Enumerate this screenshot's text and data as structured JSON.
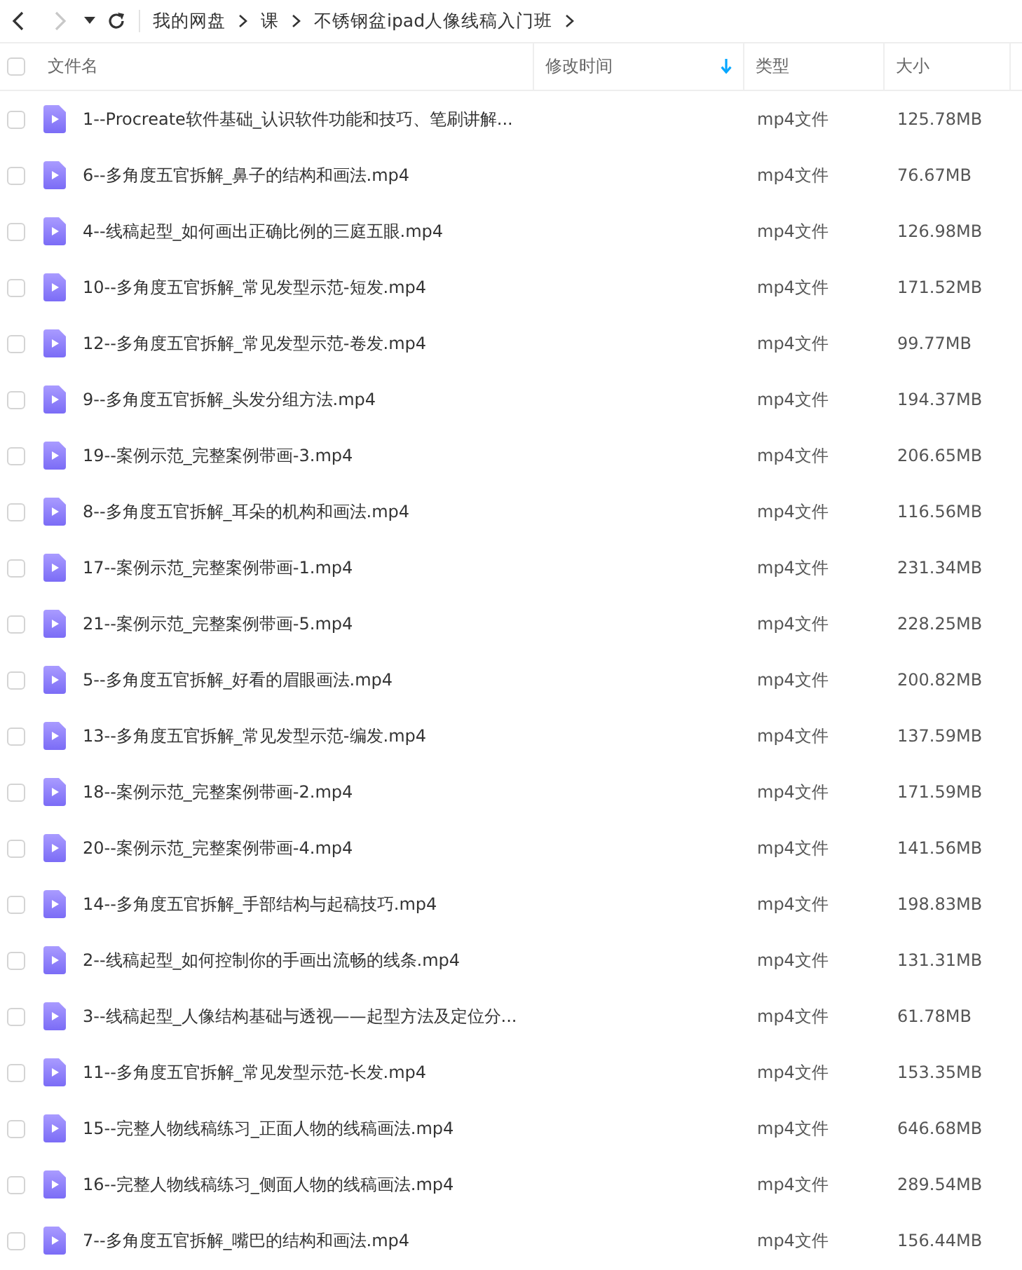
{
  "toolbar": {
    "back": {
      "disabled": false
    },
    "forward": {
      "disabled": true
    }
  },
  "breadcrumb": [
    "我的网盘",
    "课",
    "不锈钢盆ipad人像线稿入门班"
  ],
  "table": {
    "select_all": {
      "checked": false
    },
    "columns": [
      {
        "label": "文件名",
        "sorted": false
      },
      {
        "label": "修改时间",
        "sorted": true
      },
      {
        "label": "类型",
        "sorted": false
      },
      {
        "label": "大小",
        "sorted": false
      }
    ],
    "rows": [
      {
        "name": "1--Procreate软件基础_认识软件功能和技巧、笔刷讲解...",
        "type": "mp4文件",
        "size": "125.78MB",
        "checked": false
      },
      {
        "name": "6--多角度五官拆解_鼻子的结构和画法.mp4",
        "type": "mp4文件",
        "size": "76.67MB",
        "checked": false
      },
      {
        "name": "4--线稿起型_如何画出正确比例的三庭五眼.mp4",
        "type": "mp4文件",
        "size": "126.98MB",
        "checked": false
      },
      {
        "name": "10--多角度五官拆解_常见发型示范-短发.mp4",
        "type": "mp4文件",
        "size": "171.52MB",
        "checked": false
      },
      {
        "name": "12--多角度五官拆解_常见发型示范-卷发.mp4",
        "type": "mp4文件",
        "size": "99.77MB",
        "checked": false
      },
      {
        "name": "9--多角度五官拆解_头发分组方法.mp4",
        "type": "mp4文件",
        "size": "194.37MB",
        "checked": false
      },
      {
        "name": "19--案例示范_完整案例带画-3.mp4",
        "type": "mp4文件",
        "size": "206.65MB",
        "checked": false
      },
      {
        "name": "8--多角度五官拆解_耳朵的机构和画法.mp4",
        "type": "mp4文件",
        "size": "116.56MB",
        "checked": false
      },
      {
        "name": "17--案例示范_完整案例带画-1.mp4",
        "type": "mp4文件",
        "size": "231.34MB",
        "checked": false
      },
      {
        "name": "21--案例示范_完整案例带画-5.mp4",
        "type": "mp4文件",
        "size": "228.25MB",
        "checked": false
      },
      {
        "name": "5--多角度五官拆解_好看的眉眼画法.mp4",
        "type": "mp4文件",
        "size": "200.82MB",
        "checked": false
      },
      {
        "name": "13--多角度五官拆解_常见发型示范-编发.mp4",
        "type": "mp4文件",
        "size": "137.59MB",
        "checked": false
      },
      {
        "name": "18--案例示范_完整案例带画-2.mp4",
        "type": "mp4文件",
        "size": "171.59MB",
        "checked": false
      },
      {
        "name": "20--案例示范_完整案例带画-4.mp4",
        "type": "mp4文件",
        "size": "141.56MB",
        "checked": false
      },
      {
        "name": "14--多角度五官拆解_手部结构与起稿技巧.mp4",
        "type": "mp4文件",
        "size": "198.83MB",
        "checked": false
      },
      {
        "name": "2--线稿起型_如何控制你的手画出流畅的线条.mp4",
        "type": "mp4文件",
        "size": "131.31MB",
        "checked": false
      },
      {
        "name": "3--线稿起型_人像结构基础与透视——起型方法及定位分...",
        "type": "mp4文件",
        "size": "61.78MB",
        "checked": false
      },
      {
        "name": "11--多角度五官拆解_常见发型示范-长发.mp4",
        "type": "mp4文件",
        "size": "153.35MB",
        "checked": false
      },
      {
        "name": "15--完整人物线稿练习_正面人物的线稿画法.mp4",
        "type": "mp4文件",
        "size": "646.68MB",
        "checked": false
      },
      {
        "name": "16--完整人物线稿练习_侧面人物的线稿画法.mp4",
        "type": "mp4文件",
        "size": "289.54MB",
        "checked": false
      },
      {
        "name": "7--多角度五官拆解_嘴巴的结构和画法.mp4",
        "type": "mp4文件",
        "size": "156.44MB",
        "checked": false
      }
    ]
  }
}
